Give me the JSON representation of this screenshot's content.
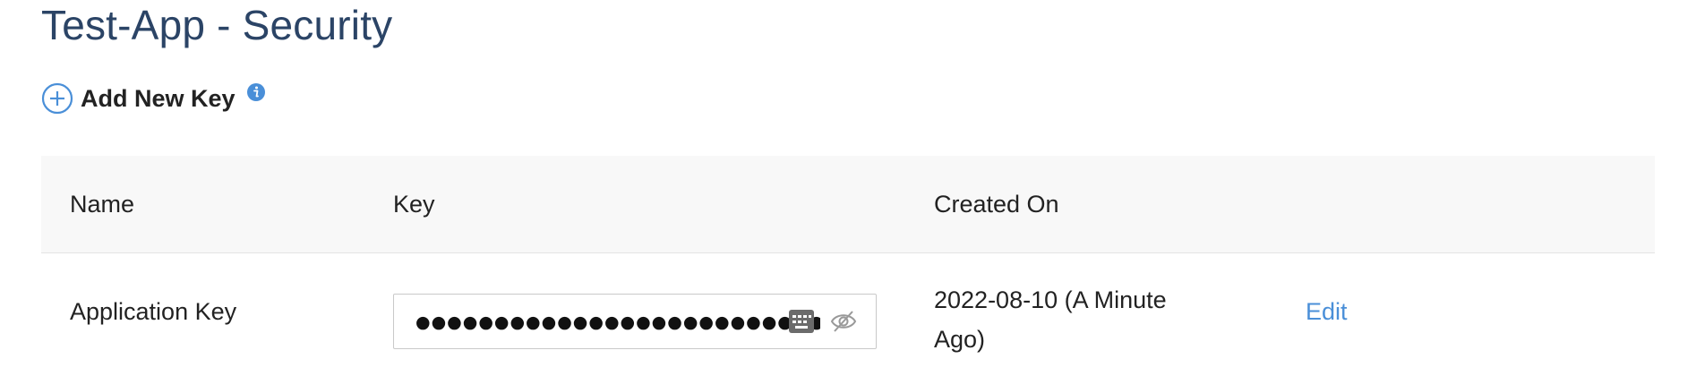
{
  "page": {
    "title": "Test-App - Security"
  },
  "toolbar": {
    "add_key_label": "Add New Key",
    "add_icon": "plus-circle-icon",
    "info_icon": "info-icon"
  },
  "table": {
    "columns": [
      "Name",
      "Key",
      "Created On",
      ""
    ],
    "rows": [
      {
        "name": "Application Key",
        "key_masked": "●●●●●●●●●●●●●●●●●●●●●●●●●●●●",
        "created_on": "2022-08-10 (A Minute Ago)",
        "action_label": "Edit",
        "key_icons": [
          "keyboard-icon",
          "eye-slash-icon"
        ]
      }
    ]
  },
  "colors": {
    "title": "#2b4466",
    "accent": "#4a8fd8",
    "header_bg": "#f8f8f8"
  }
}
